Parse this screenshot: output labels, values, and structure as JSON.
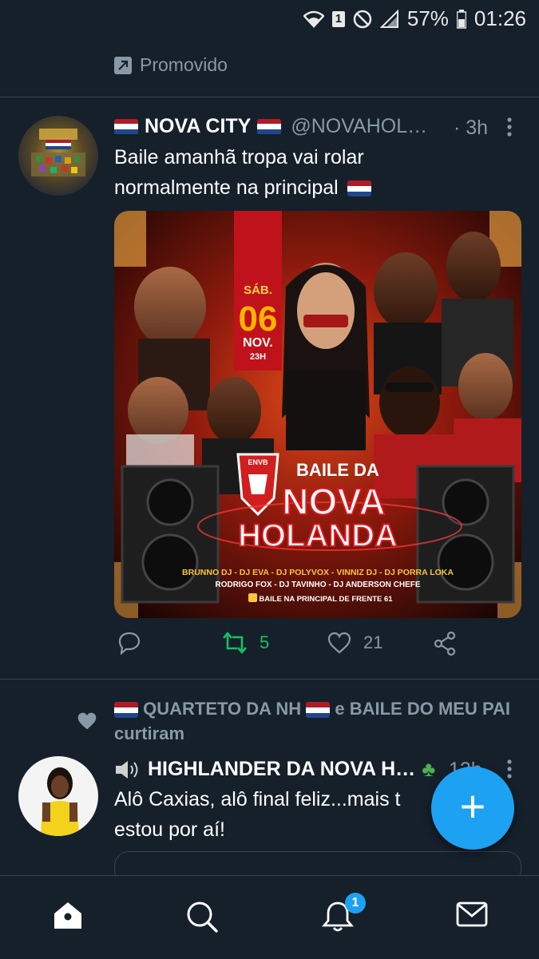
{
  "status_bar": {
    "battery": "57%",
    "time": "01:26",
    "sim_label": "1"
  },
  "promo": {
    "label": "Promovido"
  },
  "tweet1": {
    "name": "NOVA CITY",
    "handle": "@NOVAHOL…",
    "time": "· 3h",
    "text_line1": "Baile amanhã tropa vai rolar",
    "text_line2": "normalmente na principal",
    "media": {
      "day": "SÁB.",
      "date": "06",
      "month": "NOV.",
      "hour": "23H",
      "title_top": "BAILE DA",
      "title_mid": "NOVA",
      "title_bottom": "HOLANDA",
      "crest_label": "ENVB",
      "lineup1": "BRUNNO DJ - DJ EVA - DJ POLYVOX - VINNIZ DJ - DJ PORRA LOKA",
      "lineup2": "RODRIGO FOX - DJ TAVINHO - DJ ANDERSON CHEFE",
      "location": "BAILE NA PRINCIPAL DE FRENTE 61"
    },
    "retweets": "5",
    "likes": "21"
  },
  "liked_by": {
    "line1_a": "QUARTETO DA NH",
    "line1_b": "e BAILE DO MEU PAI",
    "line2": "curtiram"
  },
  "tweet2": {
    "name": "HIGHLANDER DA NOVA H…",
    "time": "12h",
    "text_line1": "Alô Caxias, alô final feliz...mais t",
    "text_line2": "estou por aí!"
  },
  "nav": {
    "notifications_badge": "1"
  },
  "colors": {
    "background": "#15202b",
    "accent": "#1da1f2",
    "retweet_green": "#17bf63",
    "muted": "#8899a6"
  }
}
